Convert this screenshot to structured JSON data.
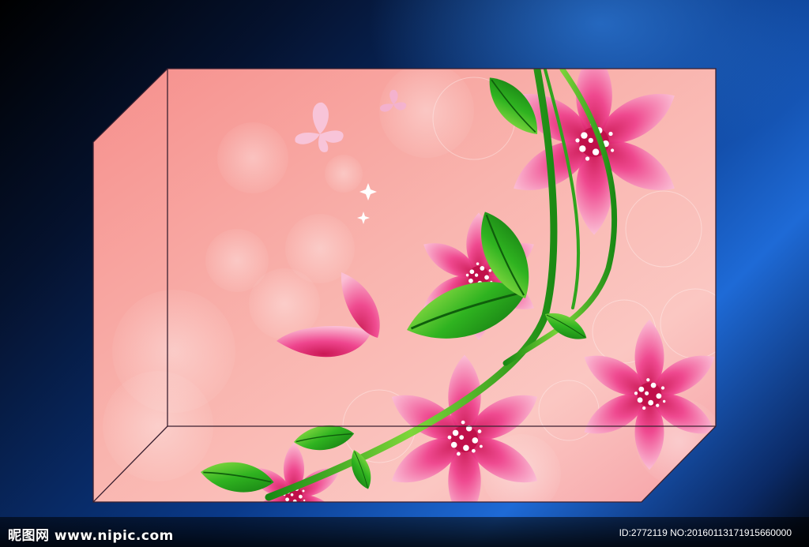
{
  "watermark": {
    "site_cn": "昵图网",
    "site_url": "www.nipic.com",
    "id_text": "ID:2772119 NO:20160113171915660000"
  },
  "colors": {
    "background": "#0a3a8a",
    "panel": "#f7a8a4",
    "flower": "#e8307a",
    "leaf": "#3cbf2a"
  }
}
